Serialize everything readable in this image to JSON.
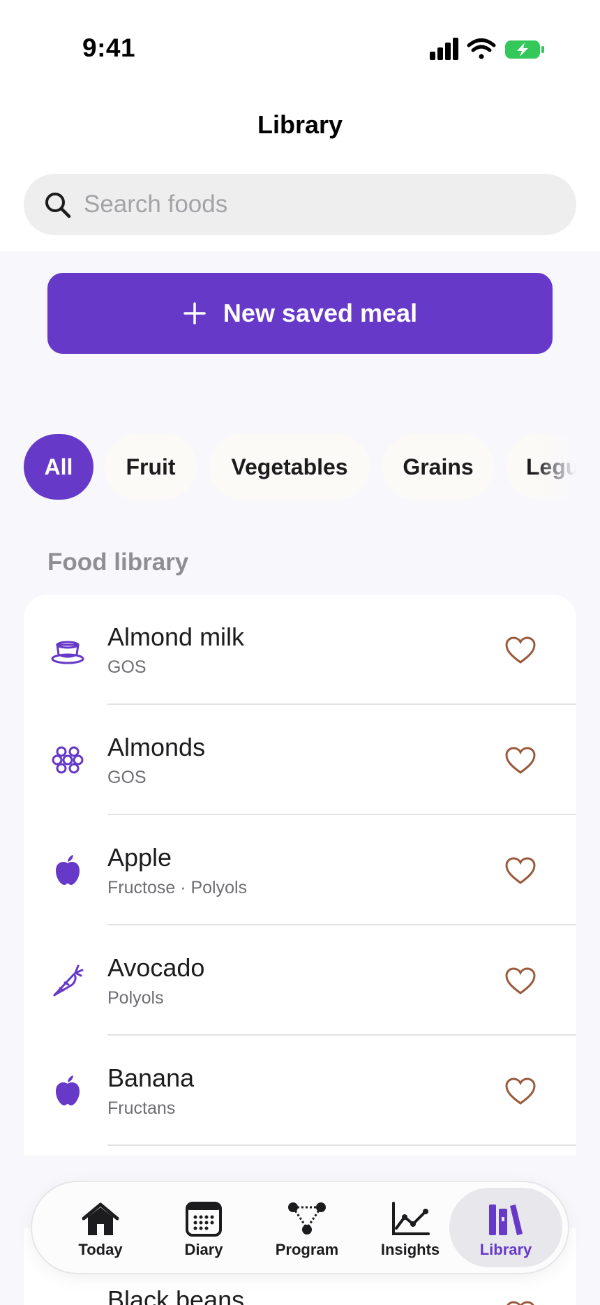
{
  "status_bar": {
    "time": "9:41"
  },
  "header": {
    "title": "Library"
  },
  "search": {
    "placeholder": "Search foods",
    "value": ""
  },
  "new_meal": {
    "label": "New saved meal"
  },
  "categories": [
    {
      "label": "All",
      "active": true
    },
    {
      "label": "Fruit",
      "active": false
    },
    {
      "label": "Vegetables",
      "active": false
    },
    {
      "label": "Grains",
      "active": false
    },
    {
      "label": "Legu",
      "active": false
    }
  ],
  "food_library": {
    "title": "Food library",
    "items": [
      {
        "name": "Almond milk",
        "tags": "GOS",
        "icon": "cup-icon"
      },
      {
        "name": "Almonds",
        "tags": "GOS",
        "icon": "nuts-icon"
      },
      {
        "name": "Apple",
        "tags": "Fructose · Polyols",
        "icon": "apple-icon"
      },
      {
        "name": "Avocado",
        "tags": "Polyols",
        "icon": "carrot-icon"
      },
      {
        "name": "Banana",
        "tags": "Fructans",
        "icon": "apple-icon"
      },
      {
        "name": "Black beans",
        "tags": "",
        "icon": "cup-icon"
      }
    ]
  },
  "tab_bar": {
    "items": [
      {
        "label": "Today",
        "icon": "house-icon"
      },
      {
        "label": "Diary",
        "icon": "calendar-icon"
      },
      {
        "label": "Program",
        "icon": "program-icon"
      },
      {
        "label": "Insights",
        "icon": "chart-icon"
      },
      {
        "label": "Library",
        "icon": "books-icon"
      }
    ],
    "active": "Library"
  },
  "colors": {
    "accent": "#6639c8",
    "heart": "#9a5a3c",
    "battery": "#34c759",
    "secondary_text": "#8e8e93"
  }
}
